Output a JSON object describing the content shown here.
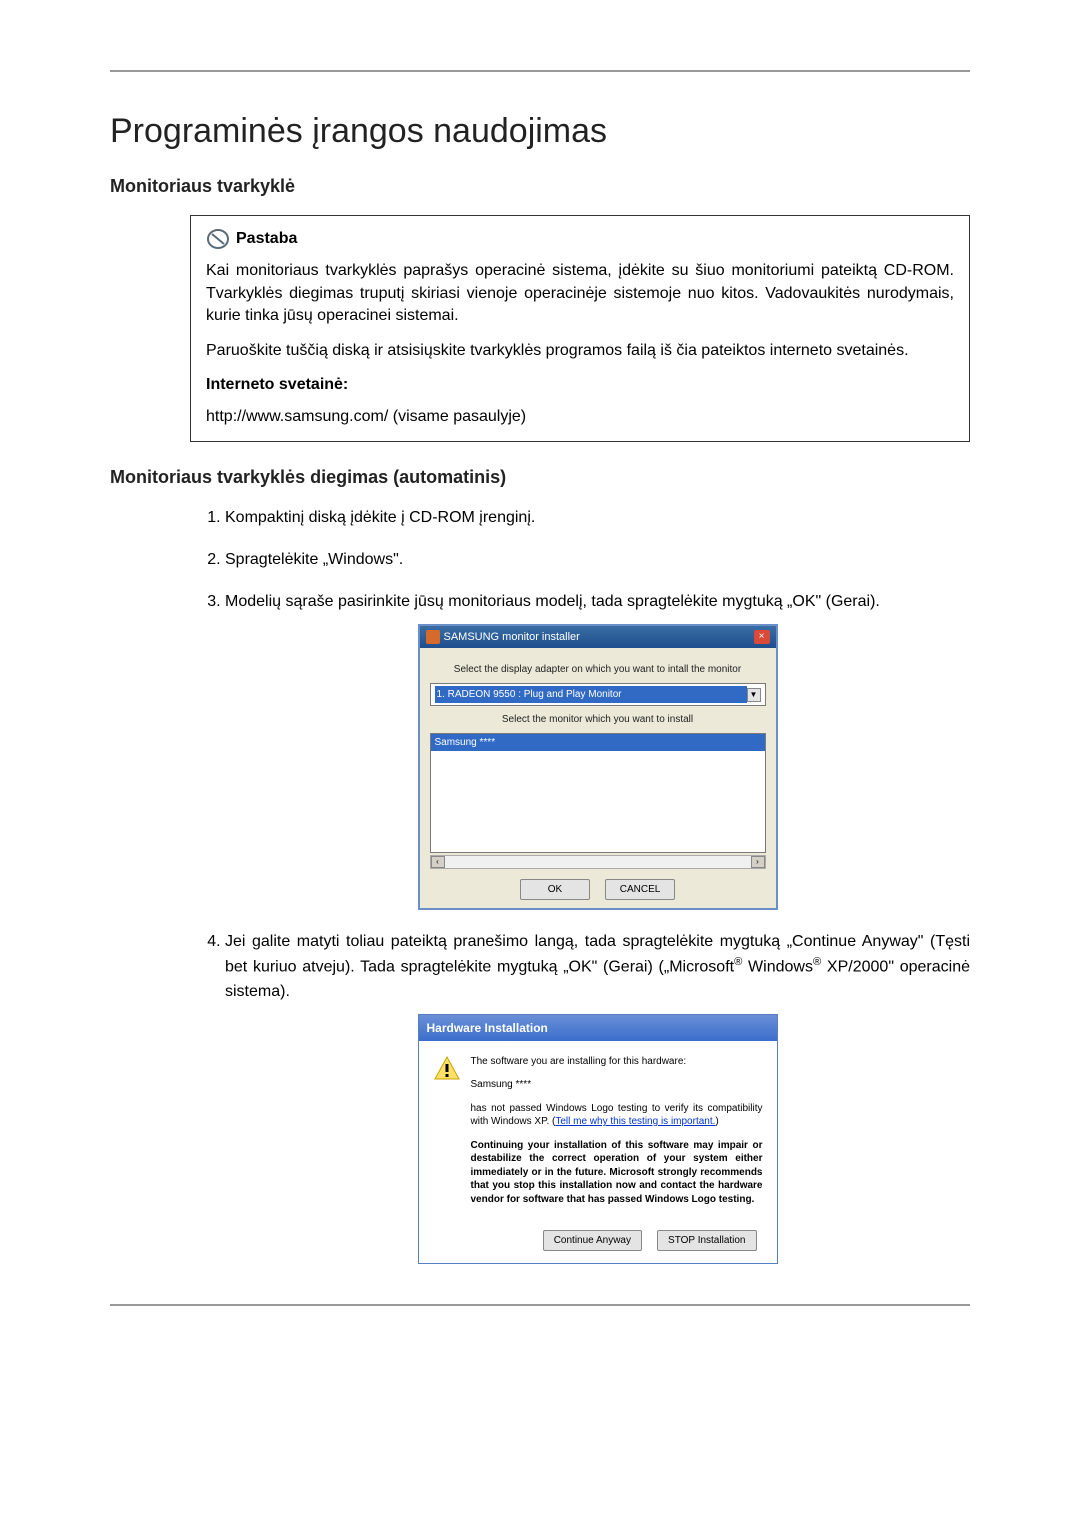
{
  "heading_main": "Programinės įrangos naudojimas",
  "section1_title": "Monitoriaus tvarkyklė",
  "note": {
    "label": "Pastaba",
    "p1": "Kai monitoriaus tvarkyklės paprašys operacinė sistema, įdėkite su šiuo monitoriumi pateiktą CD-ROM. Tvarkyklės diegimas truputį skiriasi vienoje operacinėje sistemoje nuo kitos. Vadovaukitės nurodymais, kurie tinka jūsų operacinei sistemai.",
    "p2": "Paruoškite tuščią diską ir atsisiųskite tvarkyklės programos failą iš čia pateiktos interneto svetainės.",
    "website_label": "Interneto svetainė:",
    "url": "http://www.samsung.com/ (visame pasaulyje)"
  },
  "section2_title": "Monitoriaus tvarkyklės diegimas (automatinis)",
  "steps": {
    "s1": "Kompaktinį diską įdėkite į CD-ROM įrenginį.",
    "s2": "Spragtelėkite „Windows\".",
    "s3": "Modelių sąraše pasirinkite jūsų monitoriaus modelį, tada spragtelėkite mygtuką „OK\" (Gerai).",
    "s4_a": "Jei galite matyti toliau pateiktą pranešimo langą, tada spragtelėkite mygtuką „Continue Anyway\" (Tęsti bet kuriuo atveju). Tada spragtelėkite mygtuką „OK\" (Gerai) („Microsoft",
    "s4_b": " Windows",
    "s4_c": " XP/2000\" operacinė sistema)."
  },
  "dialog1": {
    "title": "SAMSUNG monitor installer",
    "line1": "Select the display adapter on which you want to intall the monitor",
    "adapter": "1. RADEON 9550 : Plug and Play Monitor",
    "line2": "Select the monitor which you want to install",
    "listitem": "Samsung ****",
    "ok": "OK",
    "cancel": "CANCEL"
  },
  "dialog2": {
    "title": "Hardware Installation",
    "p1": "The software you are installing for this hardware:",
    "p2": "Samsung ****",
    "p3a": "has not passed Windows Logo testing to verify its compatibility with Windows XP. (",
    "p3link": "Tell me why this testing is important.",
    "p3b": ")",
    "p4": "Continuing your installation of this software may impair or destabilize the correct operation of your system either immediately or in the future. Microsoft strongly recommends that you stop this installation now and contact the hardware vendor for software that has passed Windows Logo testing.",
    "cont": "Continue Anyway",
    "stop": "STOP Installation"
  }
}
